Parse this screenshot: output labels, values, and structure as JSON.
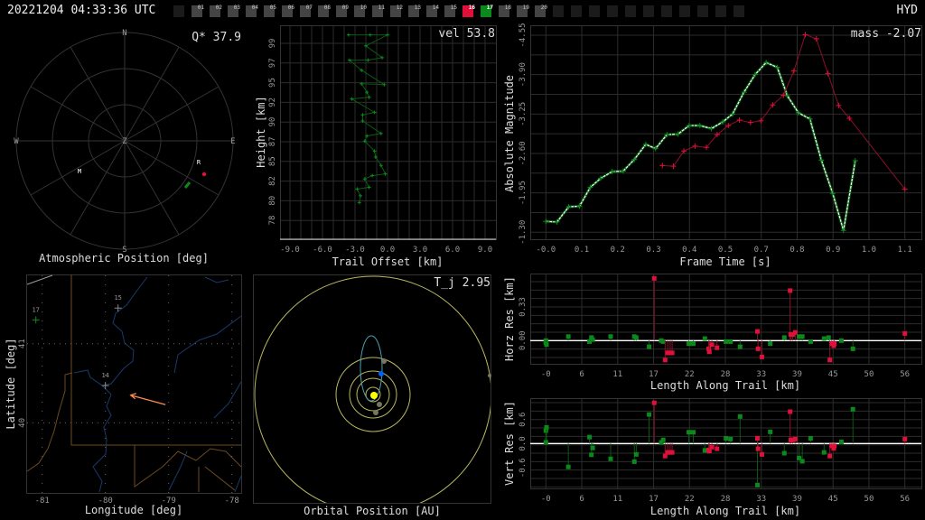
{
  "header": {
    "timestamp": "20221204 04:33:36 UTC",
    "station": "HYD",
    "slots": [
      {
        "label": "",
        "state": "off"
      },
      {
        "label": "01",
        "state": "on"
      },
      {
        "label": "02",
        "state": "on"
      },
      {
        "label": "03",
        "state": "on"
      },
      {
        "label": "04",
        "state": "on"
      },
      {
        "label": "05",
        "state": "on"
      },
      {
        "label": "06",
        "state": "on"
      },
      {
        "label": "07",
        "state": "on"
      },
      {
        "label": "08",
        "state": "on"
      },
      {
        "label": "09",
        "state": "on"
      },
      {
        "label": "10",
        "state": "on"
      },
      {
        "label": "11",
        "state": "on"
      },
      {
        "label": "12",
        "state": "on"
      },
      {
        "label": "13",
        "state": "on"
      },
      {
        "label": "14",
        "state": "on"
      },
      {
        "label": "15",
        "state": "on"
      },
      {
        "label": "16",
        "state": "red"
      },
      {
        "label": "17",
        "state": "green"
      },
      {
        "label": "18",
        "state": "on"
      },
      {
        "label": "19",
        "state": "on"
      },
      {
        "label": "20",
        "state": "on"
      },
      {
        "label": "",
        "state": "off"
      },
      {
        "label": "",
        "state": "off"
      },
      {
        "label": "",
        "state": "off"
      },
      {
        "label": "",
        "state": "off"
      },
      {
        "label": "",
        "state": "off"
      },
      {
        "label": "",
        "state": "off"
      },
      {
        "label": "",
        "state": "off"
      },
      {
        "label": "",
        "state": "off"
      },
      {
        "label": "",
        "state": "off"
      },
      {
        "label": "",
        "state": "off"
      },
      {
        "label": "",
        "state": "off"
      }
    ]
  },
  "colors": {
    "green": "#0a8a1a",
    "red": "#e0103a",
    "white": "#ffffff",
    "orange": "#ff8c4a",
    "orbit": "#b8b860",
    "comet": "#4aa0b0",
    "earth": "#0060ff",
    "sun": "#ffff00"
  },
  "chart_data": [
    {
      "id": "atmospheric",
      "type": "scatter",
      "title": "Atmospheric Position [deg]",
      "annotation": "Q* 37.9",
      "compass": {
        "n": "N",
        "s": "S",
        "e": "E",
        "w": "W",
        "z": "Z"
      },
      "markers": [
        {
          "label": "M"
        },
        {
          "label": "R"
        }
      ]
    },
    {
      "id": "trail",
      "type": "line",
      "title": "",
      "xlabel": "Trail Offset [km]",
      "ylabel": "Height [km]",
      "annotation": "vel 53.8",
      "xticks": [
        "-9.0",
        "-6.0",
        "-3.0",
        "0.0",
        "3.0",
        "6.0",
        "9.0"
      ],
      "yticks": [
        "99",
        "97",
        "95",
        "92",
        "90",
        "87",
        "85",
        "82",
        "80",
        "78"
      ],
      "xlim": [
        -9,
        9
      ],
      "ylim": [
        78,
        99
      ],
      "points": [
        [
          -3.6,
          100.0
        ],
        [
          -1.6,
          100.0
        ],
        [
          0.0,
          100.0
        ],
        [
          -2.0,
          98.7
        ],
        [
          -0.5,
          97.3
        ],
        [
          -1.8,
          97.0
        ],
        [
          -3.5,
          97.0
        ],
        [
          -2.4,
          95.8
        ],
        [
          -0.3,
          94.1
        ],
        [
          -2.4,
          94.2
        ],
        [
          -1.9,
          93.2
        ],
        [
          -1.7,
          92.6
        ],
        [
          -3.3,
          92.4
        ],
        [
          -1.2,
          90.8
        ],
        [
          -2.3,
          90.5
        ],
        [
          -2.3,
          89.8
        ],
        [
          -0.6,
          88.3
        ],
        [
          -1.9,
          88.0
        ],
        [
          -2.1,
          87.4
        ],
        [
          -1.2,
          86.2
        ],
        [
          -1.1,
          85.5
        ],
        [
          -0.6,
          84.5
        ],
        [
          -0.2,
          83.5
        ],
        [
          -1.4,
          83.3
        ],
        [
          -2.1,
          82.9
        ],
        [
          -1.7,
          81.9
        ],
        [
          -2.8,
          81.7
        ],
        [
          -2.5,
          80.9
        ],
        [
          -2.6,
          80.1
        ]
      ]
    },
    {
      "id": "magnitude",
      "type": "line",
      "xlabel": "Frame Time [s]",
      "ylabel": "Absolute Magnitude",
      "annotation": "mass -2.07",
      "xticks": [
        "-0.0",
        "0.1",
        "0.2",
        "0.3",
        "0.4",
        "0.5",
        "0.7",
        "0.8",
        "0.9",
        "1.0",
        "1.1"
      ],
      "yticks": [
        "-4.55",
        "-3.90",
        "-3.25",
        "-2.60",
        "-1.95",
        "-1.30"
      ],
      "xlim": [
        0,
        1.1
      ],
      "ylim": [
        -4.55,
        -1.3
      ],
      "series": [
        {
          "name": "station-17",
          "color": "green",
          "points": [
            [
              0,
              -1.48
            ],
            [
              0.034,
              -1.47
            ],
            [
              0.07,
              -1.72
            ],
            [
              0.103,
              -1.73
            ],
            [
              0.136,
              -2.04
            ],
            [
              0.168,
              -2.19
            ],
            [
              0.203,
              -2.3
            ],
            [
              0.237,
              -2.31
            ],
            [
              0.271,
              -2.5
            ],
            [
              0.306,
              -2.75
            ],
            [
              0.336,
              -2.68
            ],
            [
              0.371,
              -2.91
            ],
            [
              0.405,
              -2.92
            ],
            [
              0.439,
              -3.06
            ],
            [
              0.472,
              -3.06
            ],
            [
              0.507,
              -3.01
            ],
            [
              0.542,
              -3.12
            ],
            [
              0.572,
              -3.25
            ],
            [
              0.607,
              -3.61
            ],
            [
              0.641,
              -3.9
            ],
            [
              0.675,
              -4.1
            ],
            [
              0.709,
              -4.02
            ],
            [
              0.74,
              -3.55
            ],
            [
              0.774,
              -3.27
            ],
            [
              0.809,
              -3.17
            ],
            [
              0.844,
              -2.49
            ],
            [
              0.879,
              -1.94
            ],
            [
              0.912,
              -1.33
            ],
            [
              0.948,
              -2.48
            ]
          ]
        },
        {
          "name": "station-16",
          "color": "red",
          "points": [
            [
              0.357,
              -2.4
            ],
            [
              0.391,
              -2.39
            ],
            [
              0.423,
              -2.64
            ],
            [
              0.457,
              -2.72
            ],
            [
              0.492,
              -2.7
            ],
            [
              0.525,
              -2.91
            ],
            [
              0.559,
              -3.06
            ],
            [
              0.593,
              -3.15
            ],
            [
              0.627,
              -3.11
            ],
            [
              0.659,
              -3.14
            ],
            [
              0.695,
              -3.4
            ],
            [
              0.728,
              -3.56
            ],
            [
              0.76,
              -3.96
            ],
            [
              0.795,
              -4.56
            ],
            [
              0.829,
              -4.49
            ],
            [
              0.864,
              -3.92
            ],
            [
              0.897,
              -3.39
            ],
            [
              0.93,
              -3.18
            ],
            [
              1.1,
              -2.01
            ]
          ]
        }
      ]
    },
    {
      "id": "horz_res",
      "type": "scatter",
      "xlabel": "Length Along Trail [km]",
      "ylabel": "Horz Res [km]",
      "xticks": [
        "-0",
        "6",
        "11",
        "17",
        "22",
        "28",
        "33",
        "39",
        "45",
        "50",
        "56"
      ],
      "yticks": [
        "0.33",
        "0.00"
      ],
      "xlim": [
        0,
        56
      ],
      "series": [
        {
          "name": "station-17",
          "color": "green",
          "points": [
            [
              0,
              0
            ],
            [
              0,
              -0.02
            ],
            [
              0.1,
              -0.04
            ],
            [
              3.5,
              0.04
            ],
            [
              6.8,
              -0.01
            ],
            [
              7.1,
              0.03
            ],
            [
              7.3,
              0.01
            ],
            [
              10.1,
              0.04
            ],
            [
              13.8,
              0.04
            ],
            [
              14.1,
              0.03
            ],
            [
              16.1,
              -0.06
            ],
            [
              18.0,
              0
            ],
            [
              18.3,
              -0.01
            ],
            [
              22.3,
              -0.03
            ],
            [
              23.0,
              -0.03
            ],
            [
              24.8,
              0.02
            ],
            [
              28.1,
              -0.01
            ],
            [
              28.8,
              -0.01
            ],
            [
              30.3,
              -0.06
            ],
            [
              35.0,
              -0.03
            ],
            [
              37.2,
              0.03
            ],
            [
              39.5,
              0.04
            ],
            [
              40.0,
              0.04
            ],
            [
              41.3,
              -0.01
            ],
            [
              43.4,
              0.02
            ],
            [
              44.1,
              0.03
            ],
            [
              46.1,
              0
            ],
            [
              47.9,
              -0.08
            ]
          ]
        },
        {
          "name": "station-16",
          "color": "red",
          "points": [
            [
              16.9,
              0.61
            ],
            [
              18.6,
              -0.19
            ],
            [
              19.0,
              -0.12
            ],
            [
              19.4,
              -0.12
            ],
            [
              19.7,
              -0.12
            ],
            [
              25.4,
              -0.08
            ],
            [
              25.5,
              -0.11
            ],
            [
              25.9,
              -0.04
            ],
            [
              26.7,
              -0.07
            ],
            [
              33.0,
              0.09
            ],
            [
              33.1,
              -0.08
            ],
            [
              33.7,
              -0.16
            ],
            [
              38.1,
              0.49
            ],
            [
              38.2,
              0.06
            ],
            [
              38.5,
              0.06
            ],
            [
              38.9,
              0.08
            ],
            [
              44.3,
              -0.19
            ],
            [
              44.6,
              -0.03
            ],
            [
              44.9,
              -0.05
            ],
            [
              45.0,
              -0.03
            ],
            [
              56,
              0.07
            ]
          ]
        }
      ]
    },
    {
      "id": "vert_res",
      "type": "scatter",
      "xlabel": "Length Along Trail [km]",
      "ylabel": "Vert Res [km]",
      "xticks": [
        "-0",
        "6",
        "11",
        "17",
        "22",
        "28",
        "33",
        "39",
        "45",
        "50",
        "56"
      ],
      "yticks": [
        "0.6",
        "0.0",
        "-0.6"
      ],
      "xlim": [
        0,
        56
      ],
      "series": [
        {
          "name": "station-17",
          "color": "green",
          "points": [
            [
              0,
              0.32
            ],
            [
              0.1,
              0.4
            ],
            [
              0,
              0.03
            ],
            [
              3.5,
              -0.58
            ],
            [
              6.8,
              0.16
            ],
            [
              7.1,
              -0.28
            ],
            [
              7.3,
              -0.11
            ],
            [
              10.1,
              -0.38
            ],
            [
              13.8,
              -0.45
            ],
            [
              14.1,
              -0.27
            ],
            [
              16.1,
              0.72
            ],
            [
              18.0,
              0.03
            ],
            [
              18.3,
              0.09
            ],
            [
              22.3,
              0.28
            ],
            [
              23.0,
              0.28
            ],
            [
              24.8,
              -0.17
            ],
            [
              28.1,
              0.13
            ],
            [
              28.8,
              0.11
            ],
            [
              30.3,
              0.67
            ],
            [
              33.0,
              -1.03
            ],
            [
              35.0,
              0.29
            ],
            [
              37.2,
              -0.24
            ],
            [
              39.5,
              -0.36
            ],
            [
              40.0,
              -0.44
            ],
            [
              41.3,
              0.13
            ],
            [
              43.4,
              -0.22
            ],
            [
              46.1,
              0.04
            ],
            [
              47.9,
              0.85
            ]
          ]
        },
        {
          "name": "station-16",
          "color": "red",
          "points": [
            [
              16.9,
              1.01
            ],
            [
              18.6,
              -0.31
            ],
            [
              19.0,
              -0.22
            ],
            [
              19.4,
              -0.22
            ],
            [
              19.7,
              -0.22
            ],
            [
              25.4,
              -0.16
            ],
            [
              25.5,
              -0.19
            ],
            [
              25.9,
              -0.09
            ],
            [
              26.7,
              -0.13
            ],
            [
              33.0,
              0.13
            ],
            [
              33.1,
              -0.13
            ],
            [
              33.7,
              -0.27
            ],
            [
              38.1,
              0.79
            ],
            [
              38.2,
              0.09
            ],
            [
              38.5,
              0.09
            ],
            [
              38.9,
              0.11
            ],
            [
              44.3,
              -0.31
            ],
            [
              44.6,
              -0.06
            ],
            [
              44.9,
              -0.12
            ],
            [
              45.0,
              -0.06
            ],
            [
              56,
              0.11
            ]
          ]
        }
      ]
    },
    {
      "id": "map",
      "type": "scatter",
      "xlabel": "Longitude [deg]",
      "ylabel": "Latitude [deg]",
      "xticks": [
        "-81",
        "-80",
        "-79",
        "-78"
      ],
      "yticks": [
        "41",
        "40"
      ],
      "stations": [
        {
          "label": "17",
          "lon": -81.1,
          "lat": 41.3,
          "color": "green"
        },
        {
          "label": "15",
          "lon": -79.8,
          "lat": 41.45,
          "color": "gray"
        },
        {
          "label": "14",
          "lon": -80.0,
          "lat": 40.47,
          "color": "gray"
        }
      ],
      "trajectory": {
        "start": [
          -79.05,
          40.23
        ],
        "end": [
          -79.6,
          40.35
        ]
      }
    },
    {
      "id": "orbit",
      "type": "scatter",
      "title": "Orbital Position [AU]",
      "annotation": "T_j 2.95"
    }
  ]
}
